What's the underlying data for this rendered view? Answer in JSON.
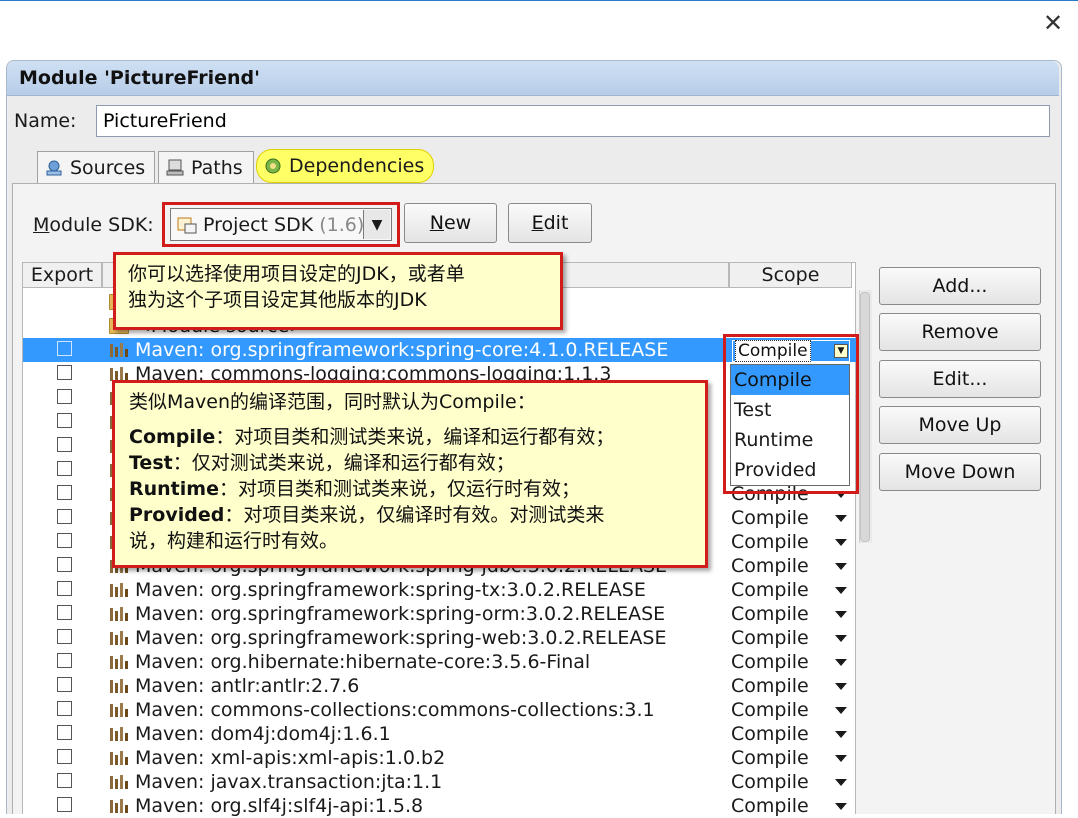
{
  "dialog": {
    "close_glyph": "✕",
    "title": "Module 'PictureFriend'"
  },
  "name": {
    "label": "Name:",
    "value": "PictureFriend"
  },
  "tabs": [
    {
      "label": "Sources",
      "icon": "sources-icon"
    },
    {
      "label": "Paths",
      "icon": "paths-icon"
    },
    {
      "label": "Dependencies",
      "icon": "dependencies-icon",
      "active": true
    }
  ],
  "sdk": {
    "label": "Module SDK:",
    "value": "Project SDK",
    "version": "(1.6)",
    "new_label": "New",
    "edit_label": "Edit"
  },
  "table": {
    "headers": {
      "export": "Export",
      "scope": "Scope"
    },
    "source_rows": [
      {
        "label": ""
      },
      {
        "label": "<Module source>"
      }
    ],
    "rows": [
      {
        "name": "Maven: org.springframework:spring-core:4.1.0.RELEASE",
        "scope": "Compile",
        "selected": true
      },
      {
        "name": "Maven: commons-logging:commons-logging:1.1.3",
        "scope": ""
      },
      {
        "name": "",
        "scope": ""
      },
      {
        "name": "",
        "scope": ""
      },
      {
        "name": "",
        "scope": ""
      },
      {
        "name": "",
        "scope": ""
      },
      {
        "name": "",
        "scope": "Compile"
      },
      {
        "name": "",
        "scope": "Compile"
      },
      {
        "name": "",
        "scope": "Compile"
      },
      {
        "name": "Maven: org.springframework:spring-jdbc:3.0.2.RELEASE",
        "scope": "Compile"
      },
      {
        "name": "Maven: org.springframework:spring-tx:3.0.2.RELEASE",
        "scope": "Compile"
      },
      {
        "name": "Maven: org.springframework:spring-orm:3.0.2.RELEASE",
        "scope": "Compile"
      },
      {
        "name": "Maven: org.springframework:spring-web:3.0.2.RELEASE",
        "scope": "Compile"
      },
      {
        "name": "Maven: org.hibernate:hibernate-core:3.5.6-Final",
        "scope": "Compile"
      },
      {
        "name": "Maven: antlr:antlr:2.7.6",
        "scope": "Compile"
      },
      {
        "name": "Maven: commons-collections:commons-collections:3.1",
        "scope": "Compile"
      },
      {
        "name": "Maven: dom4j:dom4j:1.6.1",
        "scope": "Compile"
      },
      {
        "name": "Maven: xml-apis:xml-apis:1.0.b2",
        "scope": "Compile"
      },
      {
        "name": "Maven: javax.transaction:jta:1.1",
        "scope": "Compile"
      },
      {
        "name": "Maven: org.slf4j:slf4j-api:1.5.8",
        "scope": "Compile"
      }
    ]
  },
  "side_buttons": {
    "add": "Add...",
    "remove": "Remove",
    "edit": "Edit...",
    "move_up": "Move Up",
    "move_down": "Move Down"
  },
  "scope_dropdown": {
    "current": "Compile",
    "options": [
      "Compile",
      "Test",
      "Runtime",
      "Provided"
    ]
  },
  "callouts": {
    "sdk_line1": "你可以选择使用项目设定的JDK，或者单",
    "sdk_line2": "独为这个子项目设定其他版本的JDK",
    "scope_title": "类似Maven的编译范围，同时默认为Compile：",
    "compile_term": "Compile",
    "compile_desc": "：对项目类和测试类来说，编译和运行都有效；",
    "test_term": "Test",
    "test_desc": "：仅对测试类来说，编译和运行都有效；",
    "runtime_term": "Runtime",
    "runtime_desc": "：对项目类和测试类来说，仅运行时有效；",
    "provided_term": "Provided",
    "provided_desc": "：对项目类来说，仅编译时有效。对测试类来",
    "provided_desc2": "说，构建和运行时有效。"
  },
  "colors": {
    "highlight": "#3399ff",
    "callout_bg": "#ffffcc",
    "callout_border": "#d21c1c",
    "active_tab": "#ffff66"
  }
}
